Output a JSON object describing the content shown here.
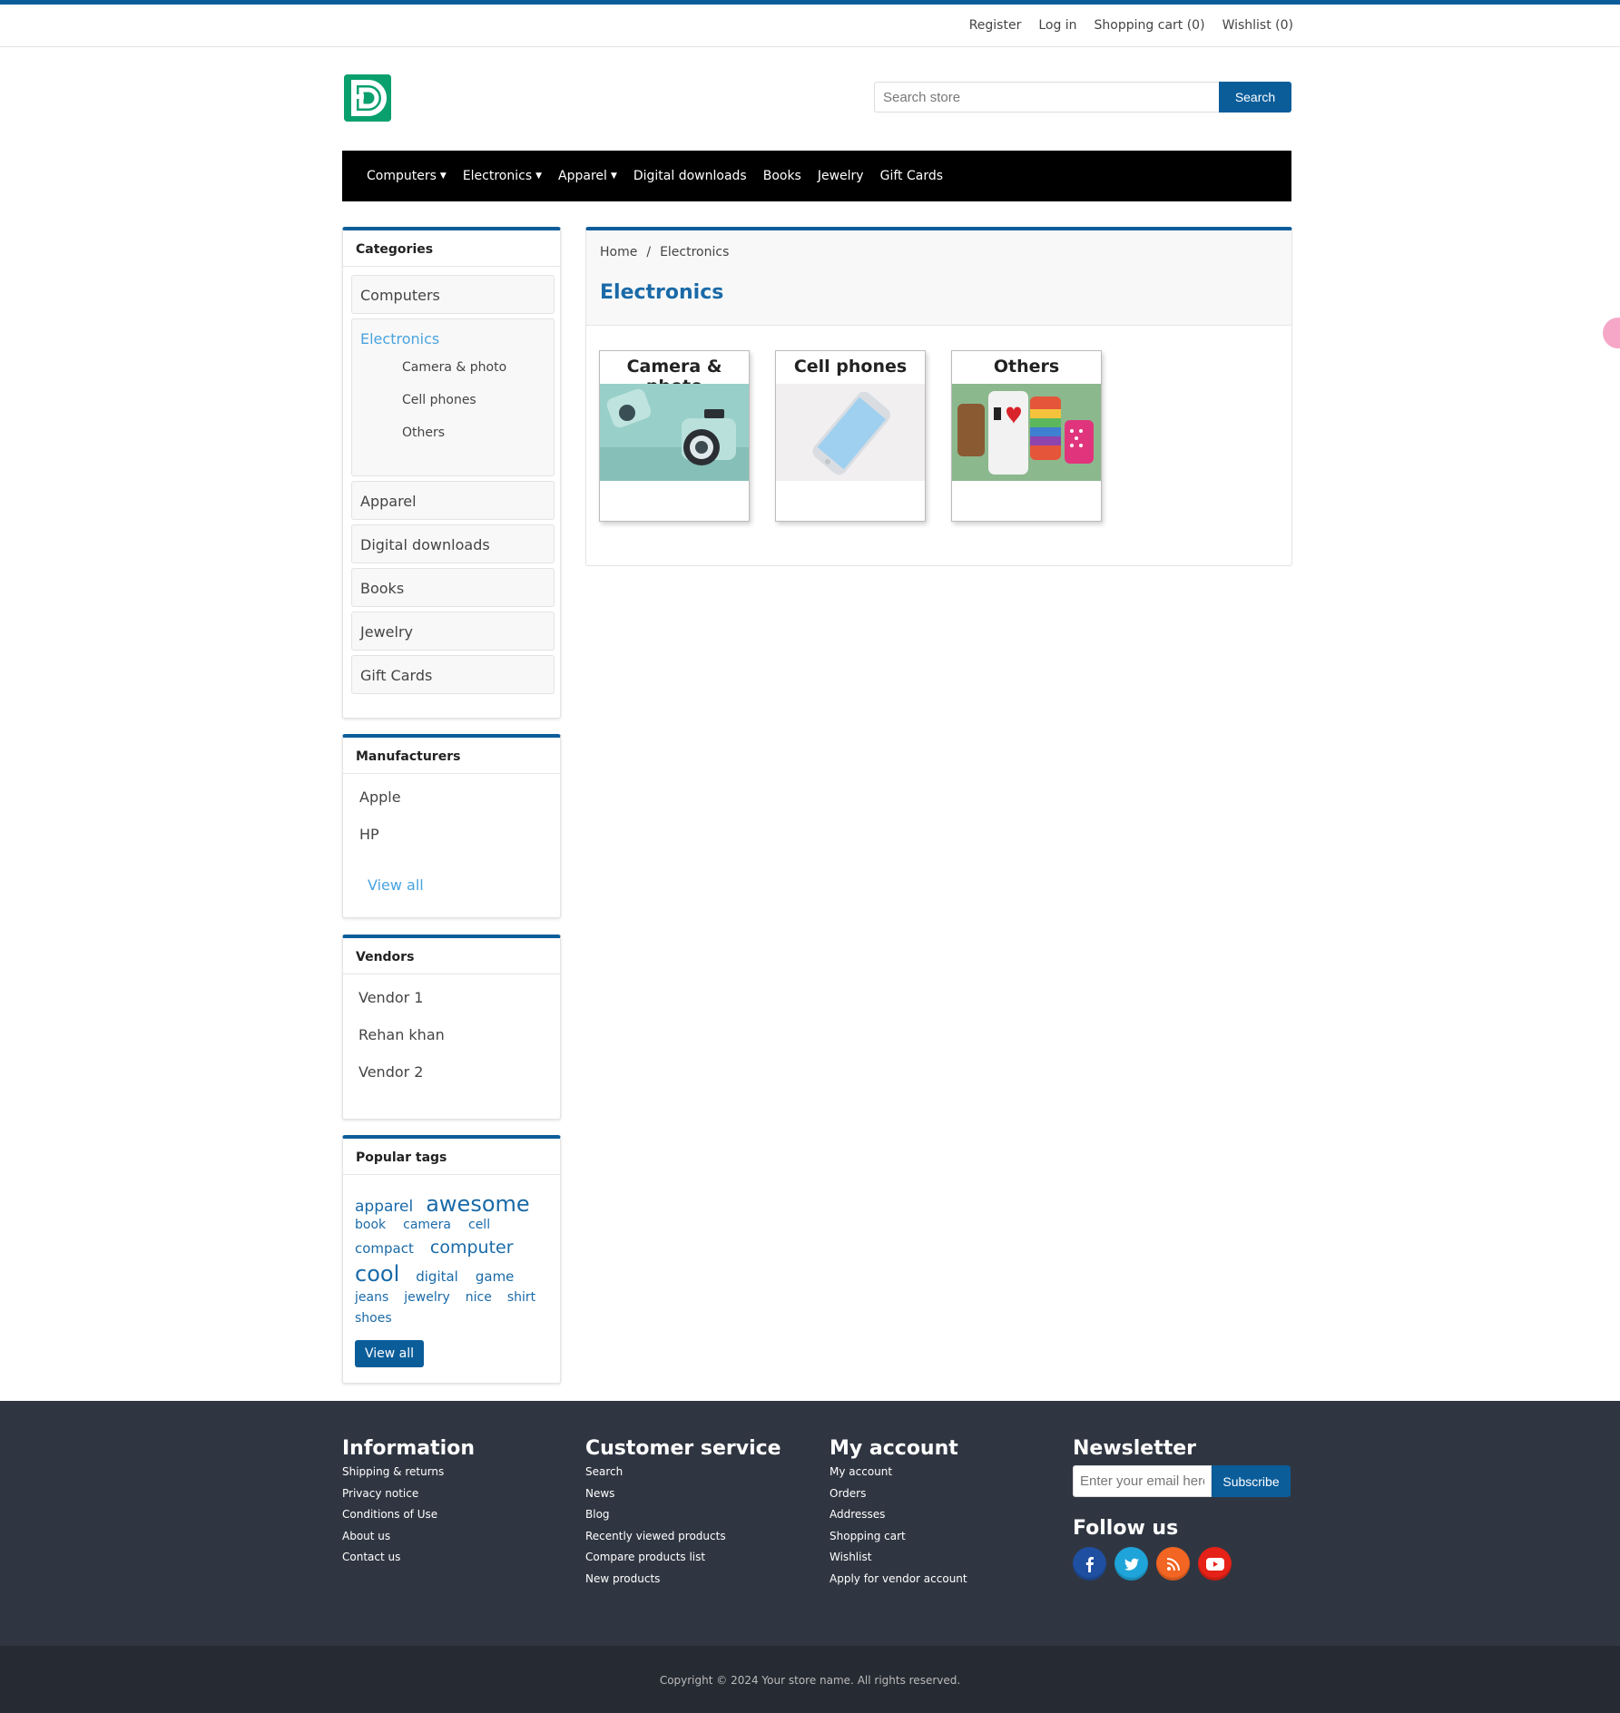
{
  "top_links": [
    "Register",
    "Log in",
    "Shopping cart (0)",
    "Wishlist (0)"
  ],
  "search": {
    "placeholder": "Search store",
    "button": "Search"
  },
  "nav": [
    {
      "label": "Computers",
      "dropdown": true
    },
    {
      "label": "Electronics",
      "dropdown": true
    },
    {
      "label": "Apparel",
      "dropdown": true
    },
    {
      "label": "Digital downloads",
      "dropdown": false
    },
    {
      "label": "Books",
      "dropdown": false
    },
    {
      "label": "Jewelry",
      "dropdown": false
    },
    {
      "label": "Gift Cards",
      "dropdown": false
    }
  ],
  "categories": {
    "title": "Categories",
    "items": [
      "Computers",
      "Electronics",
      "Apparel",
      "Digital downloads",
      "Books",
      "Jewelry",
      "Gift Cards"
    ],
    "active": "Electronics",
    "subitems": [
      "Camera & photo",
      "Cell phones",
      "Others"
    ]
  },
  "manufacturers": {
    "title": "Manufacturers",
    "items": [
      "Apple",
      "HP"
    ],
    "view_all": "View all"
  },
  "vendors": {
    "title": "Vendors",
    "items": [
      "Vendor 1",
      "Rehan khan",
      "Vendor 2"
    ]
  },
  "popular_tags": {
    "title": "Popular tags",
    "tags": [
      "apparel",
      "awesome",
      "book",
      "camera",
      "cell",
      "compact",
      "computer",
      "cool",
      "digital",
      "game",
      "jeans",
      "jewelry",
      "nice",
      "shirt",
      "shoes"
    ],
    "view_all": "View all"
  },
  "breadcrumb": {
    "home": "Home",
    "separator": "/",
    "current": "Electronics"
  },
  "page_title": "Electronics",
  "subcategories": [
    "Camera & photo",
    "Cell phones",
    "Others"
  ],
  "footer": {
    "information": {
      "title": "Information",
      "links": [
        "Shipping & returns",
        "Privacy notice",
        "Conditions of Use",
        "About us",
        "Contact us"
      ]
    },
    "customer_service": {
      "title": "Customer service",
      "links": [
        "Search",
        "News",
        "Blog",
        "Recently viewed products",
        "Compare products list",
        "New products"
      ]
    },
    "my_account": {
      "title": "My account",
      "links": [
        "My account",
        "Orders",
        "Addresses",
        "Shopping cart",
        "Wishlist",
        "Apply for vendor account"
      ]
    },
    "newsletter": {
      "title": "Newsletter",
      "placeholder": "Enter your email here...",
      "button": "Subscribe"
    },
    "follow_us": {
      "title": "Follow us",
      "icons": [
        "facebook-icon",
        "twitter-icon",
        "rss-icon",
        "youtube-icon"
      ]
    },
    "copyright": "Copyright © 2024 Your store name. All rights reserved."
  },
  "colors": {
    "accent": "#0b5d9a",
    "nav_bg": "#000000",
    "footer_bg": "#303641",
    "link_light": "#4aa3df",
    "logo": "#0aa06e"
  }
}
